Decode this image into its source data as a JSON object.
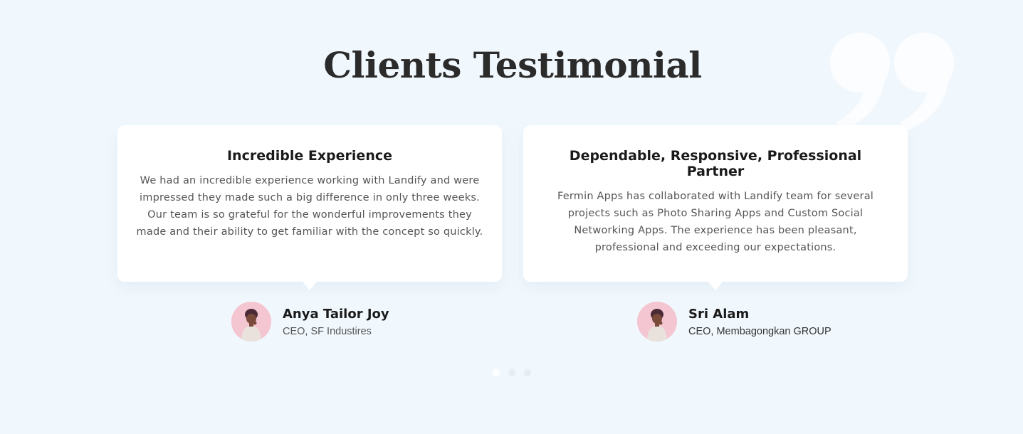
{
  "section": {
    "title": "Clients Testimonial"
  },
  "decor": {
    "quote_icon": "quote-mark-icon"
  },
  "testimonials": [
    {
      "title": "Incredible Experience",
      "text": "We had an incredible experience working with Landify and were impressed they made such a big difference in only three weeks. Our team is so grateful for the wonderful improvements they made and their ability to get familiar with the concept so quickly.",
      "author_name": "Anya Tailor Joy",
      "author_role": "CEO, SF Industires"
    },
    {
      "title": "Dependable, Responsive, Professional Partner",
      "text": "Fermin Apps has collaborated with Landify team for several projects such as Photo Sharing Apps and Custom Social Networking Apps. The experience has been pleasant, professional and exceeding our expectations.",
      "author_name": "Sri Alam",
      "author_role": "CEO, Membagongkan GROUP"
    }
  ],
  "pagination": {
    "count": 3,
    "active_index": 0
  },
  "colors": {
    "background": "#f1f8fd",
    "card": "#ffffff",
    "heading": "#2b2b2b",
    "body_text": "#555555",
    "avatar_bg": "#f4c6d2"
  }
}
